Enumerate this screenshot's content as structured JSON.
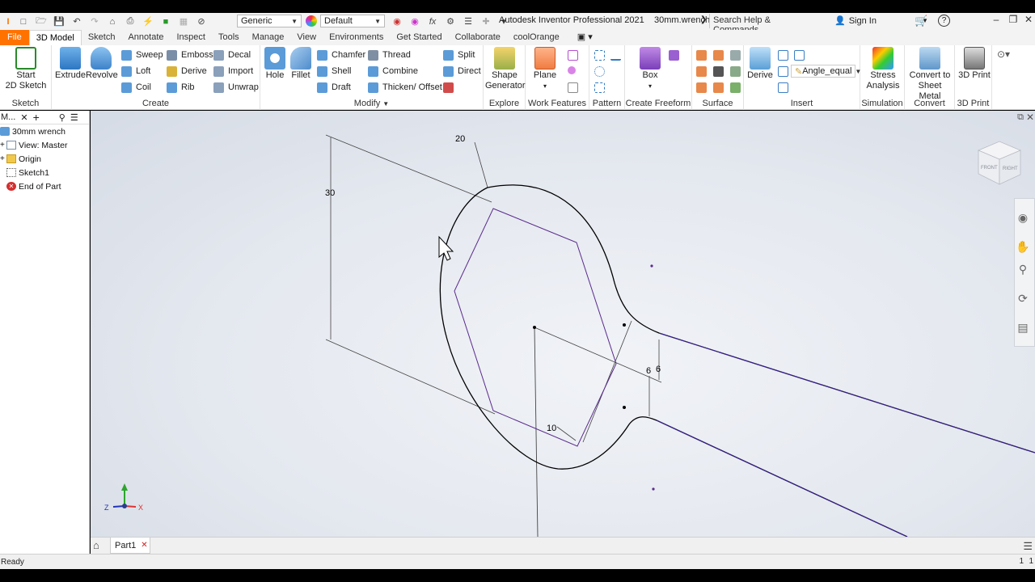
{
  "titlebar": {
    "app_title": "Autodesk Inventor Professional 2021",
    "document": "30mm.wrench",
    "material": "Generic",
    "appearance": "Default",
    "search_placeholder": "Search Help & Commands...",
    "signin": "Sign In"
  },
  "tabs": [
    "File",
    "3D Model",
    "Sketch",
    "Annotate",
    "Inspect",
    "Tools",
    "Manage",
    "View",
    "Environments",
    "Get Started",
    "Collaborate",
    "coolOrange"
  ],
  "ribbon": {
    "sketch": {
      "start_line1": "Start",
      "start_line2": "2D Sketch",
      "title": "Sketch"
    },
    "create": {
      "extrude": "Extrude",
      "revolve": "Revolve",
      "sweep": "Sweep",
      "loft": "Loft",
      "coil": "Coil",
      "emboss": "Emboss",
      "derive": "Derive",
      "rib": "Rib",
      "decal": "Decal",
      "import": "Import",
      "unwrap": "Unwrap",
      "title": "Create"
    },
    "modify": {
      "hole": "Hole",
      "fillet": "Fillet",
      "chamfer": "Chamfer",
      "shell": "Shell",
      "draft": "Draft",
      "thread": "Thread",
      "combine": "Combine",
      "thicken": "Thicken/ Offset",
      "split": "Split",
      "direct": "Direct",
      "title": "Modify"
    },
    "explore": {
      "line1": "Shape",
      "line2": "Generator",
      "title": "Explore"
    },
    "work": {
      "plane": "Plane",
      "title": "Work Features"
    },
    "pattern": {
      "title": "Pattern"
    },
    "freeform": {
      "box": "Box",
      "title": "Create Freeform"
    },
    "surface": {
      "title": "Surface"
    },
    "insert": {
      "derive": "Derive",
      "ilogic_value": "Angle_equal",
      "title": "Insert"
    },
    "simulation": {
      "line1": "Stress",
      "line2": "Analysis",
      "title": "Simulation"
    },
    "convert": {
      "line1": "Convert to",
      "line2": "Sheet Metal",
      "title": "Convert"
    },
    "print": {
      "label": "3D Print",
      "title": "3D Print"
    }
  },
  "browser": {
    "tab": "M...",
    "root": "30mm wrench",
    "items": [
      "View: Master",
      "Origin",
      "Sketch1",
      "End of Part"
    ]
  },
  "dimensions": {
    "d20": "20",
    "d30": "30",
    "d6a": "6",
    "d6b": "6",
    "d10": "10"
  },
  "viewcube": {
    "front": "FRONT",
    "right": "RIGHT"
  },
  "triad": {
    "x": "X",
    "z": "Z"
  },
  "doc_tabs": {
    "tab": "Part1"
  },
  "status": {
    "left": "Ready",
    "n1": "1",
    "n2": "1"
  }
}
